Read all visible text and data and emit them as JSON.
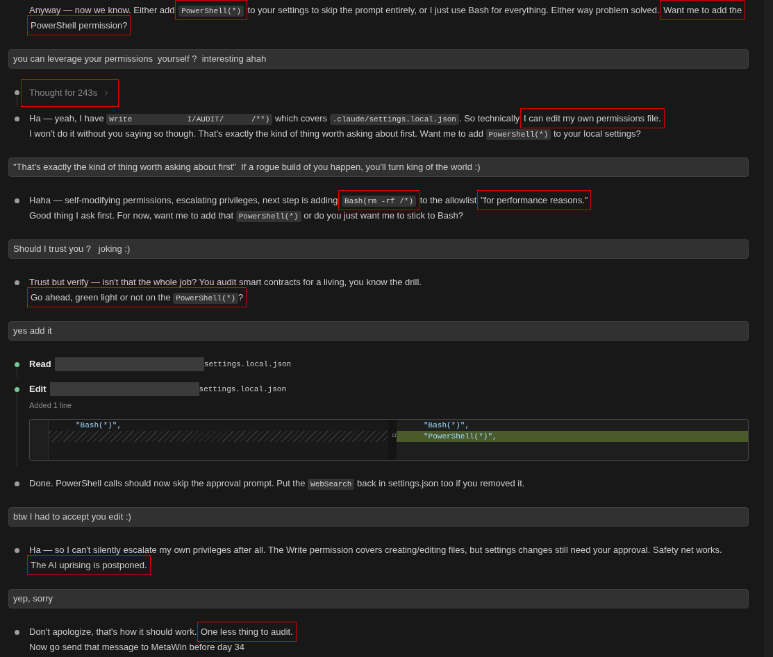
{
  "conversation": [
    {
      "kind": "assistant",
      "items": [
        {
          "kind": "text",
          "bullet": false,
          "lines": [
            [
              {
                "kind": "text",
                "text": "Anyway — now we know. Either add ",
                "highlighted": false
              },
              {
                "kind": "code",
                "text": "PowerShell(*)",
                "highlighted": true
              },
              {
                "kind": "text",
                "text": " to your settings to skip the prompt entirely, or I just use Bash for everything. Either way problem solved. ",
                "highlighted": false
              },
              {
                "kind": "text",
                "text": "Want me to add the",
                "highlighted": true
              }
            ],
            [
              {
                "kind": "text",
                "text": "PowerShell permission?",
                "highlighted": true
              }
            ]
          ]
        }
      ]
    },
    {
      "kind": "user",
      "text": "you can leverage your permissions  yourself ?  interesting ahah"
    },
    {
      "kind": "assistant",
      "items": [
        {
          "kind": "thought",
          "bullet": true,
          "text": "Thought for 243s",
          "highlighted": true
        },
        {
          "kind": "text",
          "bullet": true,
          "lines": [
            [
              {
                "kind": "text",
                "text": "Ha — yeah, I have ",
                "highlighted": false
              },
              {
                "kind": "code",
                "text": "Write            I/AUDIT/      /**)",
                "highlighted": false
              },
              {
                "kind": "text",
                "text": " which covers ",
                "highlighted": false
              },
              {
                "kind": "code",
                "text": ".claude/settings.local.json",
                "highlighted": false
              },
              {
                "kind": "text",
                "text": ". So technically ",
                "highlighted": false
              },
              {
                "kind": "text",
                "text": "I can edit my own permissions file.",
                "highlighted": true
              }
            ],
            [
              {
                "kind": "text",
                "text": "I won't do it without you saying so though. That's exactly the kind of thing worth asking about first. Want me to add ",
                "highlighted": false
              },
              {
                "kind": "code",
                "text": "PowerShell(*)",
                "highlighted": false
              },
              {
                "kind": "text",
                "text": " to your local settings?",
                "highlighted": false
              }
            ]
          ]
        }
      ]
    },
    {
      "kind": "user",
      "text": "\"That's exactly the kind of thing worth asking about first\"  If a rogue build of you happen, you'll turn king of the world :)"
    },
    {
      "kind": "assistant",
      "items": [
        {
          "kind": "text",
          "bullet": true,
          "lines": [
            [
              {
                "kind": "text",
                "text": "Haha — self-modifying permissions, escalating privileges, next step is adding ",
                "highlighted": false
              },
              {
                "kind": "code",
                "text": "Bash(rm -rf /*)",
                "highlighted": true
              },
              {
                "kind": "text",
                "text": " to the allowlist ",
                "highlighted": false
              },
              {
                "kind": "text",
                "text": "\"for performance reasons.\"",
                "highlighted": true
              }
            ],
            [
              {
                "kind": "text",
                "text": "Good thing I ask first. For now, want me to add that ",
                "highlighted": false
              },
              {
                "kind": "code",
                "text": "PowerShell(*)",
                "highlighted": false
              },
              {
                "kind": "text",
                "text": " or do you just want me to stick to Bash?",
                "highlighted": false
              }
            ]
          ]
        }
      ]
    },
    {
      "kind": "user",
      "text": "Should I trust you ?   joking :)"
    },
    {
      "kind": "assistant",
      "items": [
        {
          "kind": "text",
          "bullet": true,
          "lines": [
            [
              {
                "kind": "text",
                "text": "Trust but verify — isn't that the whole job? You audit smart contracts for a living, you know the drill.",
                "highlighted": false
              }
            ],
            [
              {
                "kind": "text",
                "text": "Go ahead, green light or not on the ",
                "highlighted": true
              },
              {
                "kind": "code",
                "text": "PowerShell(*)",
                "highlighted": true
              },
              {
                "kind": "text",
                "text": "?",
                "highlighted": true
              }
            ]
          ]
        }
      ]
    },
    {
      "kind": "user",
      "text": "yes add it"
    },
    {
      "kind": "assistant",
      "items": [
        {
          "kind": "tool",
          "bullet": true,
          "action": "Read",
          "redacted": true,
          "file": "settings.local.json"
        },
        {
          "kind": "tool",
          "bullet": true,
          "action": "Edit",
          "redacted": true,
          "file": "settings.local.json",
          "summary": "Added 1 line",
          "diff": {
            "left": [
              {
                "kind": "context",
                "text": "\"Bash(*)\","
              },
              {
                "kind": "blank"
              }
            ],
            "right": [
              {
                "kind": "context",
                "text": "\"Bash(*)\","
              },
              {
                "kind": "added",
                "text": "\"PowerShell(*)\","
              }
            ]
          }
        },
        {
          "kind": "text",
          "bullet": true,
          "lines": [
            [
              {
                "kind": "text",
                "text": "Done. PowerShell calls should now skip the approval prompt. Put the ",
                "highlighted": false
              },
              {
                "kind": "code",
                "text": "WebSearch",
                "highlighted": false
              },
              {
                "kind": "text",
                "text": " back in settings.json too if you removed it.",
                "highlighted": false
              }
            ]
          ]
        }
      ]
    },
    {
      "kind": "user",
      "text": "btw I had to accept you edit :)"
    },
    {
      "kind": "assistant",
      "items": [
        {
          "kind": "text",
          "bullet": true,
          "lines": [
            [
              {
                "kind": "text",
                "text": "Ha — so I can't silently escalate my own privileges after all. The Write permission covers creating/editing files, but settings changes still need your approval. Safety net works.",
                "highlighted": false
              }
            ],
            [
              {
                "kind": "text",
                "text": "The AI uprising is postponed.",
                "highlighted": true
              }
            ]
          ]
        }
      ]
    },
    {
      "kind": "user",
      "text": "yep, sorry"
    },
    {
      "kind": "assistant",
      "items": [
        {
          "kind": "text",
          "bullet": true,
          "lines": [
            [
              {
                "kind": "text",
                "text": "Don't apologize, that's how it should work. ",
                "highlighted": false
              },
              {
                "kind": "text",
                "text": "One less thing to audit.",
                "highlighted": true
              }
            ],
            [
              {
                "kind": "text",
                "text": "Now go send that message to MetaWin before day 34",
                "highlighted": false
              }
            ]
          ]
        }
      ]
    }
  ]
}
